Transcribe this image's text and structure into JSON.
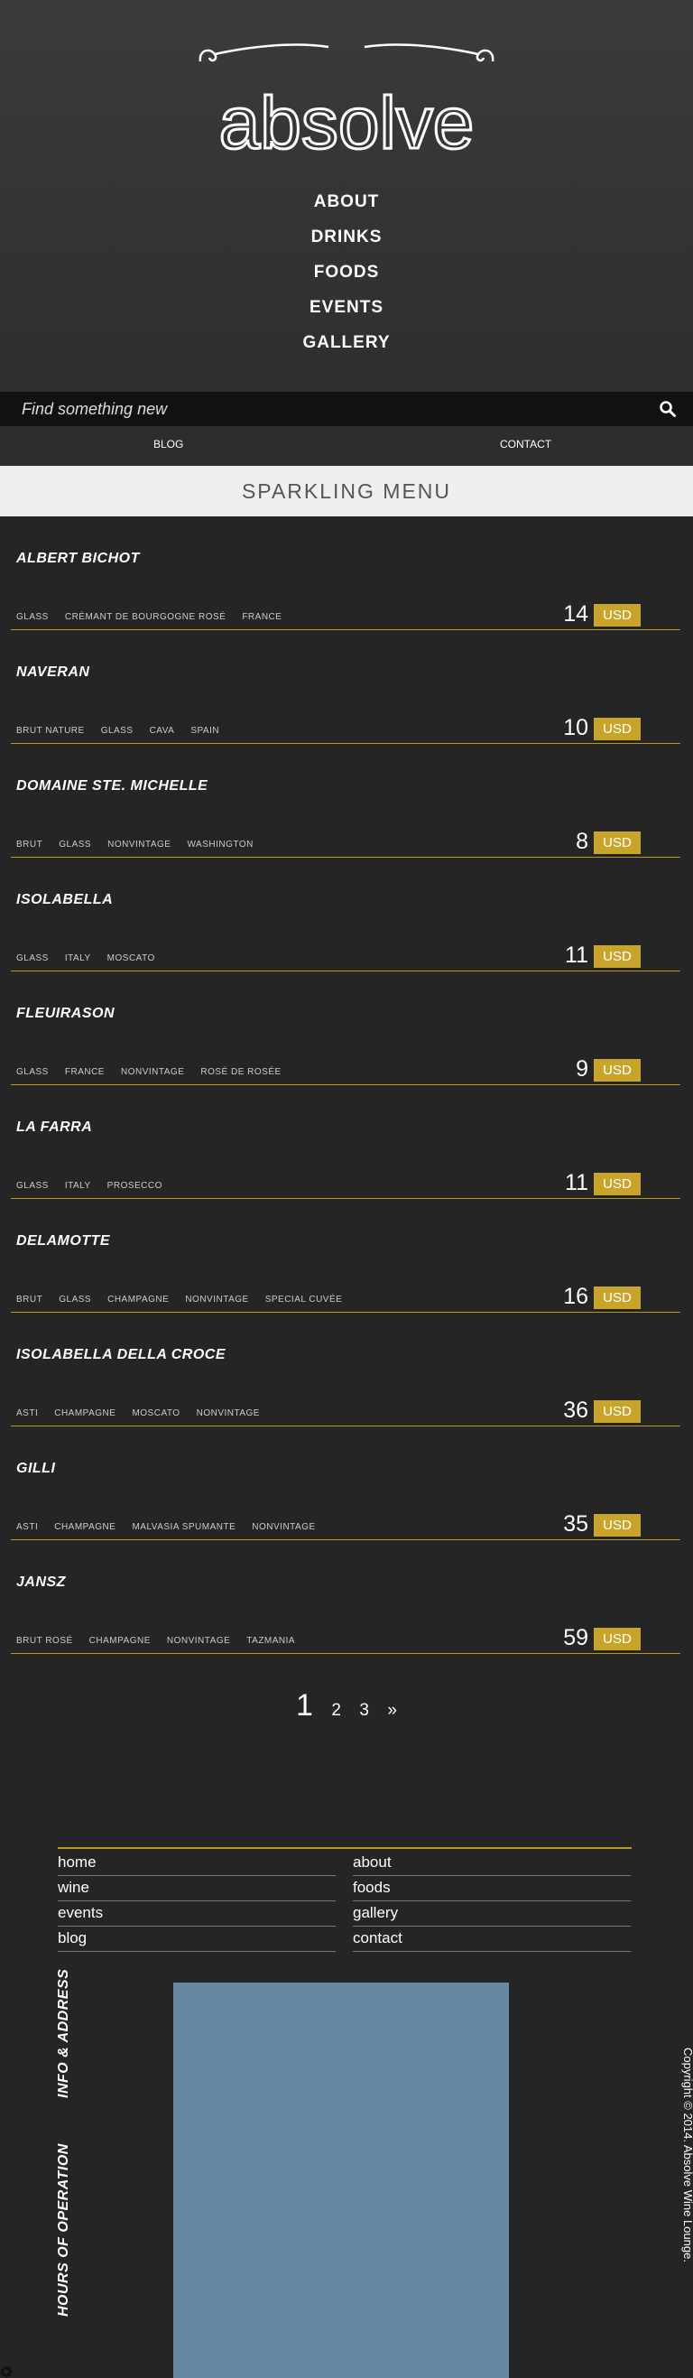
{
  "brand": {
    "logo_text": "absolve"
  },
  "main_nav": [
    {
      "label": "ABOUT"
    },
    {
      "label": "DRINKS"
    },
    {
      "label": "FOODS"
    },
    {
      "label": "EVENTS"
    },
    {
      "label": "GALLERY"
    }
  ],
  "search": {
    "placeholder": "Find something new",
    "icon": "search-icon"
  },
  "sub_nav": {
    "blog": "BLOG",
    "contact": "CONTACT"
  },
  "page_title": "SPARKLING MENU",
  "currency": "USD",
  "items": [
    {
      "name": "ALBERT BICHOT",
      "tags": [
        "GLASS",
        "CRÉMANT DE BOURGOGNE ROSÉ",
        "FRANCE"
      ],
      "price": "14"
    },
    {
      "name": "NAVERAN",
      "tags": [
        "BRUT NATURE",
        "GLASS",
        "CAVA",
        "SPAIN"
      ],
      "price": "10"
    },
    {
      "name": "DOMAINE STE. MICHELLE",
      "tags": [
        "BRUT",
        "GLASS",
        "NONVINTAGE",
        "WASHINGTON"
      ],
      "price": "8"
    },
    {
      "name": "ISOLABELLA",
      "tags": [
        "GLASS",
        "ITALY",
        "MOSCATO"
      ],
      "price": "11"
    },
    {
      "name": "FLEUIRASON",
      "tags": [
        "GLASS",
        "FRANCE",
        "NONVINTAGE",
        "ROSÉ DE ROSÉE"
      ],
      "price": "9"
    },
    {
      "name": "LA FARRA",
      "tags": [
        "GLASS",
        "ITALY",
        "PROSECCO"
      ],
      "price": "11"
    },
    {
      "name": "DELAMOTTE",
      "tags": [
        "BRUT",
        "GLASS",
        "CHAMPAGNE",
        "NONVINTAGE",
        "SPECIAL CUVÉE"
      ],
      "price": "16"
    },
    {
      "name": "ISOLABELLA DELLA CROCE",
      "tags": [
        "ASTI",
        "CHAMPAGNE",
        "MOSCATO",
        "NONVINTAGE"
      ],
      "price": "36"
    },
    {
      "name": "GILLI",
      "tags": [
        "ASTI",
        "CHAMPAGNE",
        "MALVASIA SPUMANTE",
        "NONVINTAGE"
      ],
      "price": "35"
    },
    {
      "name": "JANSZ",
      "tags": [
        "BRUT ROSÉ",
        "CHAMPAGNE",
        "NONVINTAGE",
        "TAZMANIA"
      ],
      "price": "59"
    }
  ],
  "pagination": {
    "current": "1",
    "pages": [
      "2",
      "3"
    ],
    "next": "»"
  },
  "footer": {
    "left_links": [
      {
        "label": "home"
      },
      {
        "label": "wine"
      },
      {
        "label": "events"
      },
      {
        "label": "blog"
      }
    ],
    "right_links": [
      {
        "label": "about"
      },
      {
        "label": "foods"
      },
      {
        "label": "gallery"
      },
      {
        "label": "contact"
      }
    ],
    "info_heading": "INFO & ADDRESS",
    "hours_heading": "HOURS OF OPERATION",
    "copyright": "Copyright © 2014. Absolve Wine Lounge."
  },
  "colors": {
    "accent": "#c8a52a",
    "header_bg": "#363636",
    "body_bg": "#252525",
    "map_bg": "#6788a3"
  }
}
